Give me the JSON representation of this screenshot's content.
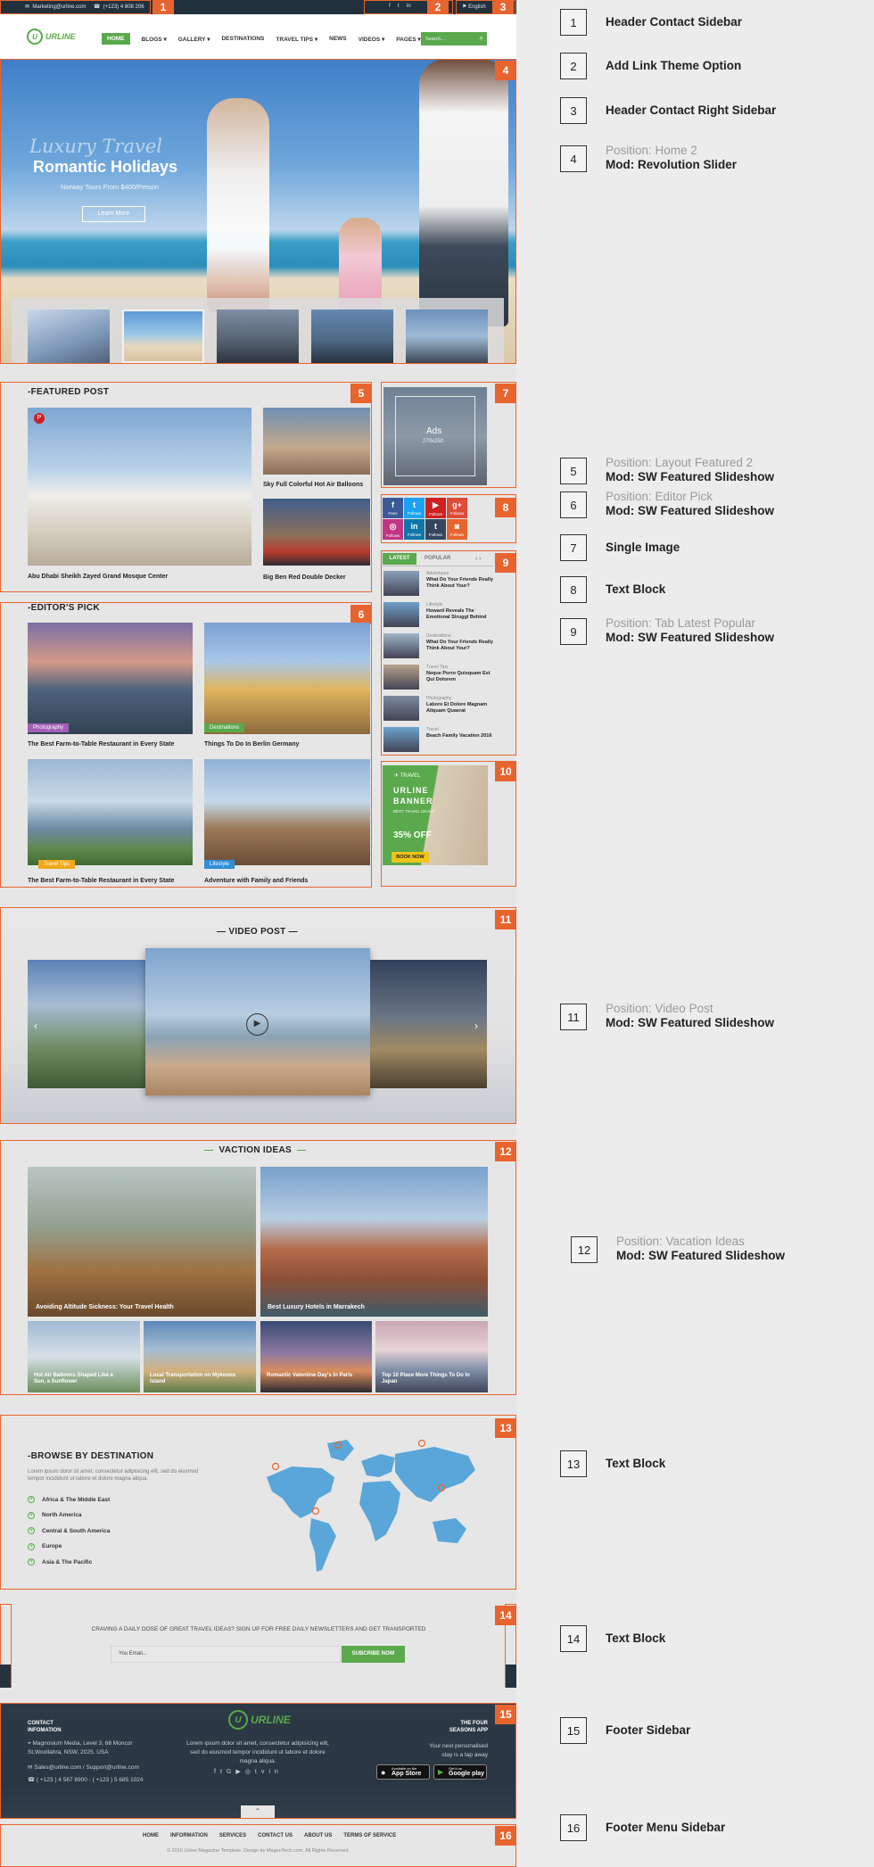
{
  "topbar": {
    "email": "Marketing@urline.com",
    "phone": "(+123) 4 808 206",
    "language": "English"
  },
  "logo": {
    "text": "URLINE"
  },
  "nav": {
    "items": [
      "HOME",
      "BLOGS",
      "GALLERY",
      "DESTINATIONS",
      "TRAVEL TIPS",
      "NEWS",
      "VIDEOS",
      "PAGES"
    ],
    "search_placeholder": "Search..."
  },
  "slider": {
    "script_title": "Luxury Travel",
    "title": "Romantic Holidays",
    "subtitle": "Norway Tours From $400/Person",
    "button": "Learn More"
  },
  "featured": {
    "heading": "FEATURED POST",
    "main_caption": "Abu Dhabi Sheikh Zayed Grand Mosque Center",
    "side1_caption": "Sky Full Colorful Hot Air Balloons",
    "side2_caption": "Big Ben Red Double Decker"
  },
  "ads": {
    "label": "Ads",
    "size": "270x250"
  },
  "social": [
    {
      "name": "f",
      "label": "Fans",
      "color": "#3b5998"
    },
    {
      "name": "t",
      "label": "Follows",
      "color": "#1da1f2"
    },
    {
      "name": "▶",
      "label": "Follows",
      "color": "#cd201f"
    },
    {
      "name": "g+",
      "label": "Follows",
      "color": "#dd4b39"
    },
    {
      "name": "◎",
      "label": "Follows",
      "color": "#c13584"
    },
    {
      "name": "in",
      "label": "Follows",
      "color": "#0e76a8"
    },
    {
      "name": "t",
      "label": "Follows",
      "color": "#35465c"
    },
    {
      "name": "◙",
      "label": "Follows",
      "color": "#e8642f"
    }
  ],
  "tabs": {
    "latest": "LATEST",
    "popular": "POPULAR",
    "items": [
      {
        "cat": "Adventures",
        "title": "What Do Your Friends Really Think About Your?"
      },
      {
        "cat": "Lifestyle",
        "title": "Howard Reveals The Emotional Struggl Behind"
      },
      {
        "cat": "Destinations",
        "title": "What Do Your Friends Really Think About Your?"
      },
      {
        "cat": "Travel Tips",
        "title": "Neque Porro Quisquam Est Qui Dolorem"
      },
      {
        "cat": "Photography",
        "title": "Labore Et Dolore Magnam Aliquam Quaerat"
      },
      {
        "cat": "Travel",
        "title": "Beach Family Vacation 2016"
      }
    ]
  },
  "banner": {
    "kicker": "TRAVEL",
    "title1": "URLINE",
    "title2": "BANNER",
    "subtitle": "BEST TRAVEL DEALS",
    "discount": "35% OFF",
    "button": "BOOK NOW"
  },
  "editors": {
    "heading": "EDITOR'S PICK",
    "items": [
      {
        "tag": "Photography",
        "tag_color": "#a25fb5",
        "caption": "The Best Farm-to-Table Restaurant in Every State"
      },
      {
        "tag": "Destinations",
        "tag_color": "#5aa94c",
        "caption": "Things To Do In Berlin Germany"
      },
      {
        "tag": "Travel Tips",
        "tag_color": "#f0a818",
        "caption": "The Best Farm-to-Table Restaurant in Every State"
      },
      {
        "tag": "Lifestyle",
        "tag_color": "#2f8fd8",
        "caption": "Adventure with Family and Friends"
      }
    ]
  },
  "video": {
    "heading": "— VIDEO POST —"
  },
  "vacation": {
    "heading": "VACTION IDEAS",
    "big": [
      "Avoiding Altitude Sickness: Your Travel Health",
      "Best Luxury Hotels in Marrakech"
    ],
    "small": [
      "Hot Air Balloons Shaped Like a Sun, a Sunflower",
      "Local Transportation on Mykonos Island",
      "Romantic Valentine Day's In Paris",
      "Top 10 Place More Things To Do In Japan"
    ]
  },
  "browse": {
    "heading": "BROWSE BY DESTINATION",
    "text": "Lorem ipsum dolor sit amet, consectetur adipisicing elit, sed do eiusmod tempor incididunt ut labore et dolore magna aliqua.",
    "items": [
      "Africa & The Middle East",
      "North America",
      "Central & South America",
      "Europe",
      "Asia & The Pacific"
    ]
  },
  "newsletter": {
    "text": "CRAVING A DAILY DOSE OF GREAT TRAVEL IDEAS? SIGN UP FOR FREE DAILY NEWSLETTERS AND GET TRANSPORTED",
    "placeholder": "You Email...",
    "button": "SUBCRIBE NOW"
  },
  "footer": {
    "contact_title1": "CONTACT",
    "contact_title2": "INFOMATION",
    "address": "Magnosium Media, Level 3, 68 Moncor St,Woollahra, NSW, 2025, USA",
    "emails": "Sales@urline.com / Support@urline.com",
    "phones": "( +123 ) 4 567 8900 - ( +123 ) 5 685 1024",
    "about": "Lorem ipsum dolor sit amet, consectetur adipisicing elit, sed do eiusmod tempor incididunt ut labore et dolore magna aliqua.",
    "app_title1": "THE FOUR",
    "app_title2": "SEASONS APP",
    "app_text1": "Your next personalised",
    "app_text2": "stay is a tap away",
    "appstore_small": "Available on the",
    "appstore": "App Store",
    "gplay_small": "Get it on",
    "gplay": "Google play"
  },
  "footer_menu": {
    "items": [
      "HOME",
      "INFORMATION",
      "SERVICES",
      "CONTACT US",
      "ABOUT US",
      "TERMS OF SERVICE"
    ],
    "copyright": "© 2016 Urline Magazine Template. Design by MagenTech.com. All Rights Reserved."
  },
  "badges": [
    "1",
    "2",
    "3",
    "4",
    "5",
    "6",
    "7",
    "8",
    "9",
    "10",
    "11",
    "12",
    "13",
    "14",
    "15",
    "16"
  ],
  "annotations": [
    {
      "num": "1",
      "pos": "",
      "mod": "Header Contact Sidebar"
    },
    {
      "num": "2",
      "pos": "",
      "mod": "Add Link Theme Option"
    },
    {
      "num": "3",
      "pos": "",
      "mod": "Header Contact Right Sidebar"
    },
    {
      "num": "4",
      "pos": "Position: Home 2",
      "mod": "Mod: Revolution Slider"
    },
    {
      "num": "5",
      "pos": "Position: Layout Featured 2",
      "mod": "Mod: SW Featured Slideshow"
    },
    {
      "num": "6",
      "pos": "Position: Editor Pick",
      "mod": "Mod: SW Featured Slideshow"
    },
    {
      "num": "7",
      "pos": "",
      "mod": "Single Image"
    },
    {
      "num": "8",
      "pos": "",
      "mod": "Text Block"
    },
    {
      "num": "9",
      "pos": "Position: Tab Latest Popular",
      "mod": "Mod: SW Featured Slideshow"
    },
    {
      "num": "11",
      "pos": "Position: Video Post",
      "mod": "Mod: SW Featured Slideshow"
    },
    {
      "num": "12",
      "pos": "Position: Vacation Ideas",
      "mod": "Mod: SW Featured Slideshow"
    },
    {
      "num": "13",
      "pos": "",
      "mod": "Text Block"
    },
    {
      "num": "14",
      "pos": "",
      "mod": "Text Block"
    },
    {
      "num": "15",
      "pos": "",
      "mod": "Footer Sidebar"
    },
    {
      "num": "16",
      "pos": "",
      "mod": "Footer Menu Sidebar"
    }
  ]
}
